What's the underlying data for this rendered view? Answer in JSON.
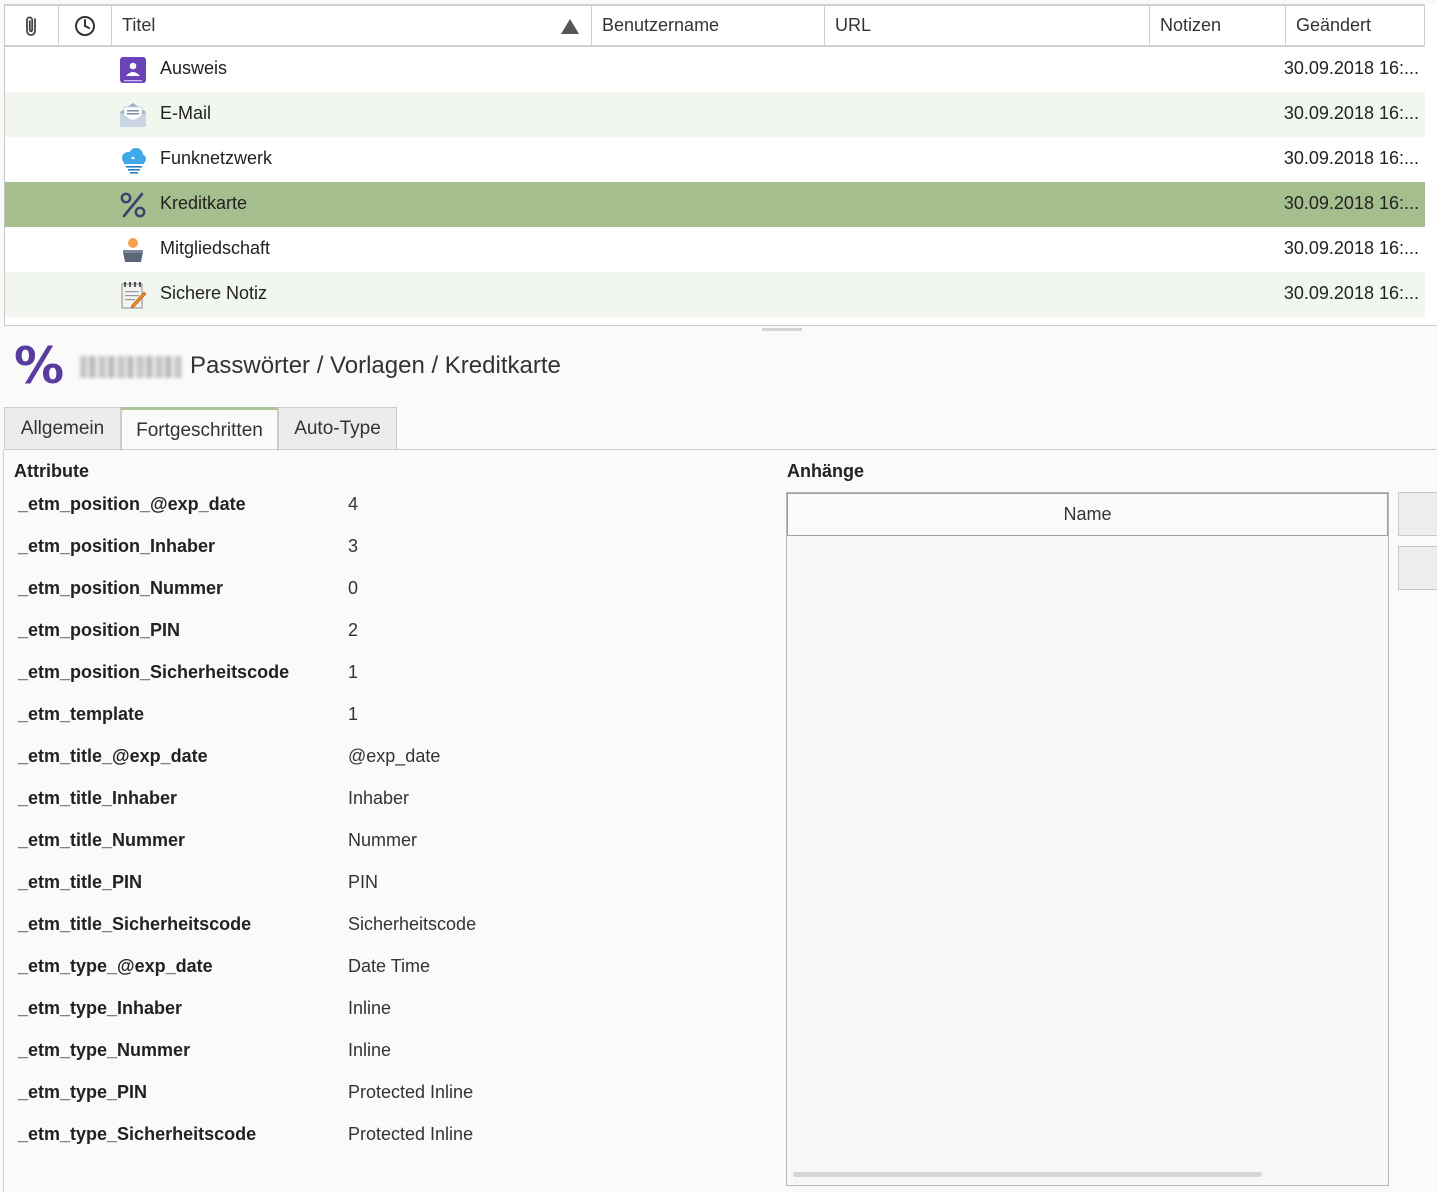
{
  "table": {
    "columns": {
      "attachment_icon": "paperclip-icon",
      "time_icon": "clock-icon",
      "title": "Titel",
      "username": "Benutzername",
      "url": "URL",
      "notes": "Notizen",
      "modified": "Geändert"
    },
    "rows": [
      {
        "icon": "id-card-icon",
        "title": "Ausweis",
        "modified": "30.09.2018 16:..."
      },
      {
        "icon": "email-icon",
        "title": "E-Mail",
        "modified": "30.09.2018 16:..."
      },
      {
        "icon": "wifi-cloud-icon",
        "title": "Funknetzwerk",
        "modified": "30.09.2018 16:..."
      },
      {
        "icon": "percent-icon",
        "title": "Kreditkarte",
        "modified": "30.09.2018 16:..."
      },
      {
        "icon": "member-icon",
        "title": "Mitgliedschaft",
        "modified": "30.09.2018 16:..."
      },
      {
        "icon": "note-icon",
        "title": "Sichere Notiz",
        "modified": "30.09.2018 16:..."
      }
    ],
    "selected_row": "Kreditkarte"
  },
  "detail": {
    "icon": "percent-icon",
    "breadcrumb": "Passwörter / Vorlagen / Kreditkarte",
    "tabs": [
      "Allgemein",
      "Fortgeschritten",
      "Auto-Type"
    ],
    "active_tab": "Fortgeschritten"
  },
  "attributes": {
    "title": "Attribute",
    "items": [
      {
        "key": "_etm_position_@exp_date",
        "value": "4"
      },
      {
        "key": "_etm_position_Inhaber",
        "value": "3"
      },
      {
        "key": "_etm_position_Nummer",
        "value": "0"
      },
      {
        "key": "_etm_position_PIN",
        "value": "2"
      },
      {
        "key": "_etm_position_Sicherheitscode",
        "value": "1"
      },
      {
        "key": "_etm_template",
        "value": "1"
      },
      {
        "key": "_etm_title_@exp_date",
        "value": "@exp_date"
      },
      {
        "key": "_etm_title_Inhaber",
        "value": "Inhaber"
      },
      {
        "key": "_etm_title_Nummer",
        "value": "Nummer"
      },
      {
        "key": "_etm_title_PIN",
        "value": "PIN"
      },
      {
        "key": "_etm_title_Sicherheitscode",
        "value": "Sicherheitscode"
      },
      {
        "key": "_etm_type_@exp_date",
        "value": "Date Time"
      },
      {
        "key": "_etm_type_Inhaber",
        "value": "Inline"
      },
      {
        "key": "_etm_type_Nummer",
        "value": "Inline"
      },
      {
        "key": "_etm_type_PIN",
        "value": "Protected Inline"
      },
      {
        "key": "_etm_type_Sicherheitscode",
        "value": "Protected Inline"
      }
    ]
  },
  "attachments": {
    "title": "Anhänge",
    "column_name": "Name"
  },
  "colors": {
    "accent_purple": "#5a3ca0",
    "selected_row": "#a5be8e",
    "alt_row": "#f1f7ef",
    "active_tab_border": "#a9c796"
  }
}
